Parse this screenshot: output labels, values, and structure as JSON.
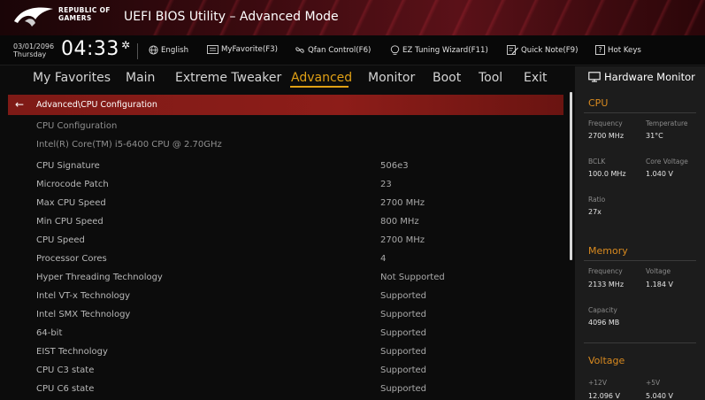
{
  "titlebar": {
    "brand_line1": "REPUBLIC OF",
    "brand_line2": "GAMERS",
    "app_title": "UEFI BIOS Utility – Advanced Mode"
  },
  "toolbar": {
    "date": "03/01/2096",
    "day": "Thursday",
    "time": "04:33",
    "language": "English",
    "myfavorite": "MyFavorite(F3)",
    "qfan": "Qfan Control(F6)",
    "ez_tuning": "EZ Tuning Wizard(F11)",
    "quick_note": "Quick Note(F9)",
    "hotkeys": "Hot Keys",
    "hotkeys_badge": "?"
  },
  "nav": {
    "tabs": [
      {
        "label": "My Favorites"
      },
      {
        "label": "Main"
      },
      {
        "label": "Extreme Tweaker"
      },
      {
        "label": "Advanced"
      },
      {
        "label": "Monitor"
      },
      {
        "label": "Boot"
      },
      {
        "label": "Tool"
      },
      {
        "label": "Exit"
      }
    ],
    "active": "Advanced"
  },
  "breadcrumb": {
    "arrow": "←",
    "path": "Advanced\\CPU Configuration"
  },
  "settings": {
    "section_title": "CPU Configuration",
    "cpu_name": "Intel(R) Core(TM) i5-6400 CPU @ 2.70GHz",
    "rows": [
      {
        "label": "CPU Signature",
        "value": "506e3"
      },
      {
        "label": "Microcode Patch",
        "value": "23"
      },
      {
        "label": "Max CPU Speed",
        "value": "2700 MHz"
      },
      {
        "label": "Min CPU Speed",
        "value": "800 MHz"
      },
      {
        "label": "CPU Speed",
        "value": "2700 MHz"
      },
      {
        "label": "Processor Cores",
        "value": "4"
      },
      {
        "label": "Hyper Threading  Technology",
        "value": "Not Supported"
      },
      {
        "label": "Intel VT-x Technology",
        "value": "Supported"
      },
      {
        "label": "Intel SMX Technology",
        "value": "Supported"
      },
      {
        "label": "64-bit",
        "value": "Supported"
      },
      {
        "label": "EIST Technology",
        "value": "Supported"
      },
      {
        "label": "CPU C3 state",
        "value": "Supported"
      },
      {
        "label": "CPU C6 state",
        "value": "Supported"
      }
    ]
  },
  "hardware_monitor": {
    "title": "Hardware Monitor",
    "cpu": {
      "title": "CPU",
      "frequency_label": "Frequency",
      "frequency": "2700 MHz",
      "temperature_label": "Temperature",
      "temperature": "31°C",
      "bclk_label": "BCLK",
      "bclk": "100.0 MHz",
      "core_voltage_label": "Core Voltage",
      "core_voltage": "1.040 V",
      "ratio_label": "Ratio",
      "ratio": "27x"
    },
    "memory": {
      "title": "Memory",
      "frequency_label": "Frequency",
      "frequency": "2133 MHz",
      "voltage_label": "Voltage",
      "voltage": "1.184 V",
      "capacity_label": "Capacity",
      "capacity": "4096 MB"
    },
    "voltage": {
      "title": "Voltage",
      "v12_label": "+12V",
      "v12": "12.096 V",
      "v5_label": "+5V",
      "v5": "5.040 V"
    }
  },
  "colors": {
    "accent": "#e0a015",
    "breadcrumb_bg": "#8d1d19",
    "monitor_section": "#d98a1f"
  }
}
